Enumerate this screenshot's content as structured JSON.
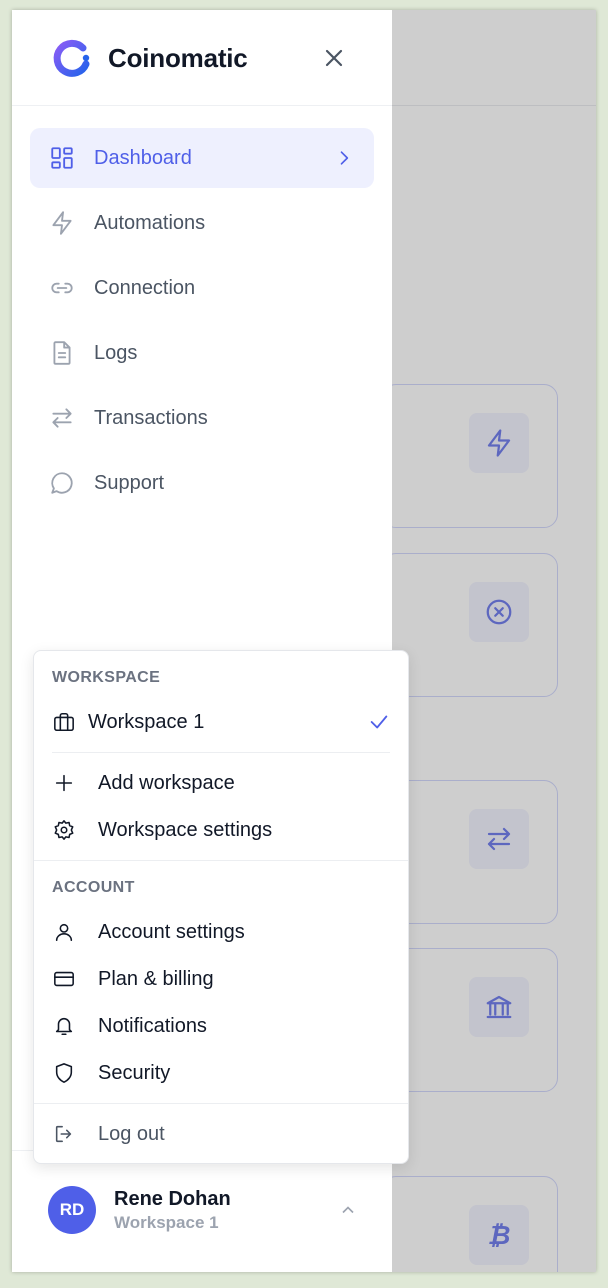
{
  "app": {
    "name": "Coinomatic"
  },
  "colors": {
    "accent": "#4f5fe8",
    "active_bg": "#eef0fe",
    "text": "#111827",
    "muted": "#9ca3af"
  },
  "nav": {
    "items": [
      {
        "label": "Dashboard",
        "icon": "dashboard-grid-icon",
        "active": true
      },
      {
        "label": "Automations",
        "icon": "lightning-icon",
        "active": false
      },
      {
        "label": "Connection",
        "icon": "link-icon",
        "active": false
      },
      {
        "label": "Logs",
        "icon": "document-icon",
        "active": false
      },
      {
        "label": "Transactions",
        "icon": "arrows-swap-icon",
        "active": false
      },
      {
        "label": "Support",
        "icon": "chat-bubble-icon",
        "active": false
      }
    ]
  },
  "menu": {
    "workspace_title": "WORKSPACE",
    "workspaces": [
      {
        "label": "Workspace 1",
        "icon": "briefcase-icon",
        "selected": true
      }
    ],
    "add_workspace": {
      "label": "Add workspace",
      "icon": "plus-icon"
    },
    "workspace_settings": {
      "label": "Workspace settings",
      "icon": "gear-icon"
    },
    "account_title": "ACCOUNT",
    "account_items": [
      {
        "label": "Account settings",
        "icon": "user-icon"
      },
      {
        "label": "Plan & billing",
        "icon": "credit-card-icon"
      },
      {
        "label": "Notifications",
        "icon": "bell-icon"
      },
      {
        "label": "Security",
        "icon": "shield-icon"
      }
    ],
    "logout": {
      "label": "Log out",
      "icon": "logout-icon"
    }
  },
  "user": {
    "initials": "RD",
    "name": "Rene Dohan",
    "workspace": "Workspace 1"
  },
  "background_cards": [
    {
      "icon": "lightning-icon"
    },
    {
      "icon": "x-circle-icon"
    },
    {
      "icon": "arrows-swap-icon"
    },
    {
      "icon": "bank-icon"
    },
    {
      "icon": "bitcoin-icon"
    }
  ]
}
